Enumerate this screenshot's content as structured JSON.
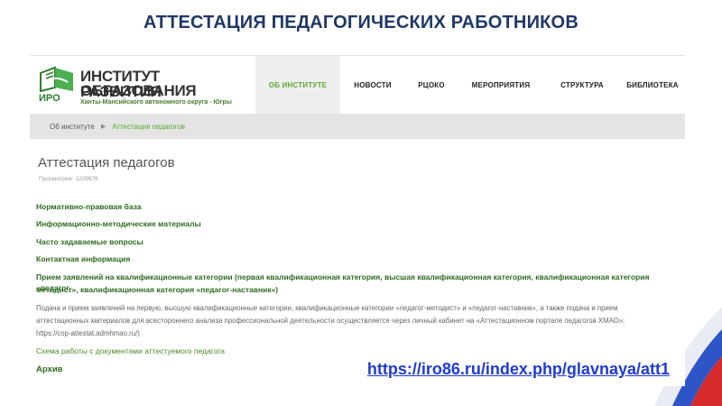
{
  "slide": {
    "title": "АТТЕСТАЦИЯ ПЕДАГОГИЧЕСКИХ РАБОТНИКОВ",
    "url": "https://iro86.ru/index.php/glavnaya/att1"
  },
  "header": {
    "logo": {
      "line1": "ИНСТИТУТ РАЗВИТИЯ",
      "line2": "ОБРАЗОВАНИЯ",
      "abbr": "ИРО",
      "subtitle": "Ханты-Мансийского автономного округа - Югры"
    },
    "nav": [
      {
        "label": "ОБ ИНСТИТУТЕ",
        "active": true
      },
      {
        "label": "НОВОСТИ",
        "active": false
      },
      {
        "label": "РЦОКО",
        "active": false
      },
      {
        "label": "МЕРОПРИЯТИЯ",
        "active": false
      },
      {
        "label": "СТРУКТУРА",
        "active": false
      },
      {
        "label": "БИБЛИОТЕКА",
        "active": false
      }
    ]
  },
  "breadcrumb": {
    "parent": "Об институте",
    "current": "Аттестация педагогов"
  },
  "page": {
    "heading": "Аттестация педагогов",
    "views": "Просмотров: 1229978",
    "links": {
      "normative": "Нормативно-правовая база",
      "methodical": "Информационно-методические материалы",
      "faq": "Часто задаваемые вопросы",
      "contacts": "Контактная информация",
      "applications_line1": "Прием заявлений на квалификационные категории (первая квалификационная категория, высшая квалификационная категория, квалификационная категория «педагог-",
      "applications_line2": "методист», квалификационная категория «педагог-наставник»)",
      "scheme": "Схема работы с документами аттестуемого педагога",
      "archive": "Архив"
    },
    "paragraph": {
      "line1": "Подача и прием заявлений на первую, высшую квалификационные категории, квалификационные категории «педагог-методист» и «педагог-наставник», а также подача и прием",
      "line2": "аттестационных материалов для всестороннего анализа профессиональной деятельности осуществляется через личный кабинет на «Аттестационном портале педагогов ХМАО»:",
      "line3": "https://cop-attestat.admhmao.ru/)"
    }
  }
}
